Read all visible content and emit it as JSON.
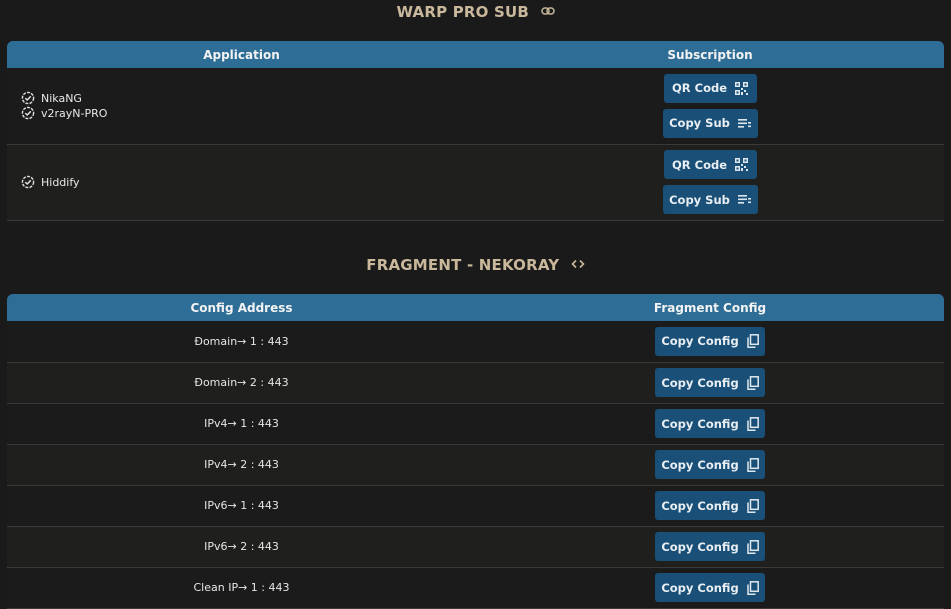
{
  "warp_section": {
    "title": "WARP PRO SUB",
    "link_icon": "link-icon",
    "headers": {
      "application": "Application",
      "subscription": "Subscription"
    },
    "rows": [
      {
        "apps": [
          "NikaNG",
          "v2rayN-PRO"
        ],
        "qr_label": "QR Code",
        "copy_label": "Copy Sub"
      },
      {
        "apps": [
          "Hiddify"
        ],
        "qr_label": "QR Code",
        "copy_label": "Copy Sub"
      }
    ]
  },
  "fragment_section": {
    "title": "FRAGMENT - NEKORAY",
    "code_icon": "code-icon",
    "headers": {
      "address": "Config Address",
      "config": "Fragment Config"
    },
    "rows": [
      {
        "address": "Đomain→ 1 : 443",
        "button": "Copy Config"
      },
      {
        "address": "Đomain→ 2 : 443",
        "button": "Copy Config"
      },
      {
        "address": "IPv4→ 1 : 443",
        "button": "Copy Config"
      },
      {
        "address": "IPv4→ 2 : 443",
        "button": "Copy Config"
      },
      {
        "address": "IPv6→ 1 : 443",
        "button": "Copy Config"
      },
      {
        "address": "IPv6→ 2 : 443",
        "button": "Copy Config"
      },
      {
        "address": "Clean IP→ 1 : 443",
        "button": "Copy Config"
      }
    ]
  },
  "colors": {
    "header_bg": "#2e6d96",
    "button_bg": "#1a5077",
    "title_color": "#c9b89b",
    "page_bg": "#1a1a1a"
  }
}
